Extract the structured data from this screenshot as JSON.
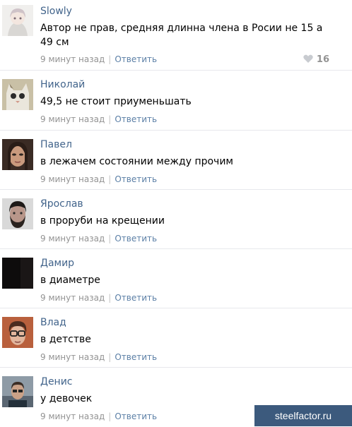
{
  "comments": [
    {
      "author": "Slowly",
      "text": "Автор не прав, средняя длинна члена в Росии не 15 а 49 см",
      "time": "9 минут назад",
      "reply": "Ответить",
      "likes": "16",
      "avatar": "avatar-anime-girl"
    },
    {
      "author": "Николай",
      "text": "49,5 не стоит приуменьшать",
      "time": "9 минут назад",
      "reply": "Ответить",
      "avatar": "avatar-cat"
    },
    {
      "author": "Павел",
      "text": "в лежачем состоянии между прочим",
      "time": "9 минут назад",
      "reply": "Ответить",
      "avatar": "avatar-woman"
    },
    {
      "author": "Ярослав",
      "text": "в проруби на крещении",
      "time": "9 минут назад",
      "reply": "Ответить",
      "avatar": "avatar-bearded-man"
    },
    {
      "author": "Дамир",
      "text": "в диаметре",
      "time": "9 минут назад",
      "reply": "Ответить",
      "avatar": "avatar-dark"
    },
    {
      "author": "Влад",
      "text": "в детстве",
      "time": "9 минут назад",
      "reply": "Ответить",
      "avatar": "avatar-glasses-man"
    },
    {
      "author": "Денис",
      "text": "у девочек",
      "time": "9 минут назад",
      "reply": "Ответить",
      "avatar": "avatar-man-photo"
    }
  ],
  "like_icon": "heart-icon",
  "watermark": "steelfactor.ru",
  "colors": {
    "author": "#42648b",
    "meta": "#939393",
    "reply": "#5b7fa6",
    "divider": "#e7e8ec",
    "watermark_bg": "#3c5a7d"
  }
}
